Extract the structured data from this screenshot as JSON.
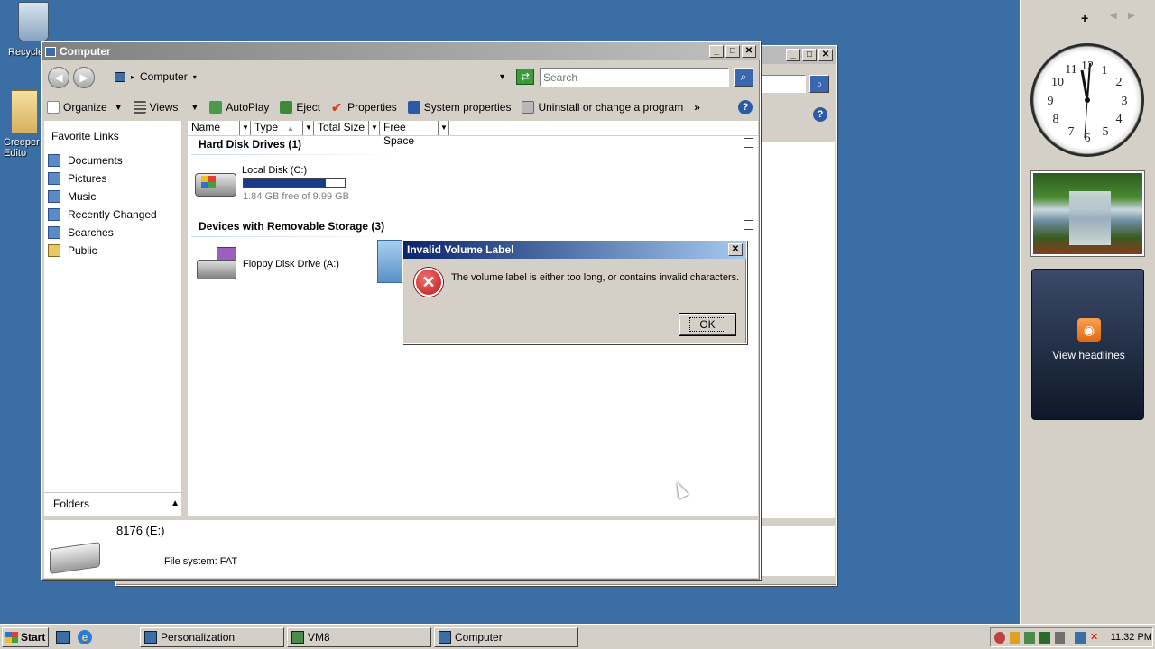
{
  "desktop": {
    "icons": [
      {
        "label": "Recycle"
      },
      {
        "label": "Creeper\nEdito"
      }
    ]
  },
  "bg_window": {
    "title": ""
  },
  "explorer": {
    "title": "Computer",
    "address": "Computer",
    "search_placeholder": "Search",
    "toolbar": {
      "organize": "Organize",
      "views": "Views",
      "autoplay": "AutoPlay",
      "eject": "Eject",
      "properties": "Properties",
      "system_properties": "System properties",
      "uninstall": "Uninstall or change a program",
      "more": "»"
    },
    "sidebar": {
      "header": "Favorite Links",
      "items": [
        {
          "label": "Documents"
        },
        {
          "label": "Pictures"
        },
        {
          "label": "Music"
        },
        {
          "label": "Recently Changed"
        },
        {
          "label": "Searches"
        },
        {
          "label": "Public"
        }
      ],
      "folders_label": "Folders"
    },
    "columns": [
      "Name",
      "Type",
      "Total Size",
      "Free Space"
    ],
    "groups": {
      "hdd": {
        "title": "Hard Disk Drives (1)",
        "drive_name": "Local Disk (C:)",
        "drive_usage_fraction": 0.816,
        "drive_free": "1.84 GB free of 9.99 GB"
      },
      "removable": {
        "title": "Devices with Removable Storage (3)",
        "floppy": "Floppy Disk Drive (A:)"
      }
    },
    "details": {
      "name": "8176 (E:)",
      "filesystem": "File system: FAT"
    }
  },
  "dialog": {
    "title": "Invalid Volume Label",
    "message": "The volume label is either too long, or contains invalid characters.",
    "ok": "OK"
  },
  "sidebar_gadgets": {
    "feed": "View headlines"
  },
  "taskbar": {
    "start": "Start",
    "tasks": [
      {
        "label": "Personalization"
      },
      {
        "label": "VM8"
      },
      {
        "label": "Computer"
      }
    ],
    "clock": "11:32 PM"
  },
  "colors": {
    "desktop": "#3a6ea5",
    "active_title": "#0a246a",
    "error_red": "#cc2222"
  }
}
